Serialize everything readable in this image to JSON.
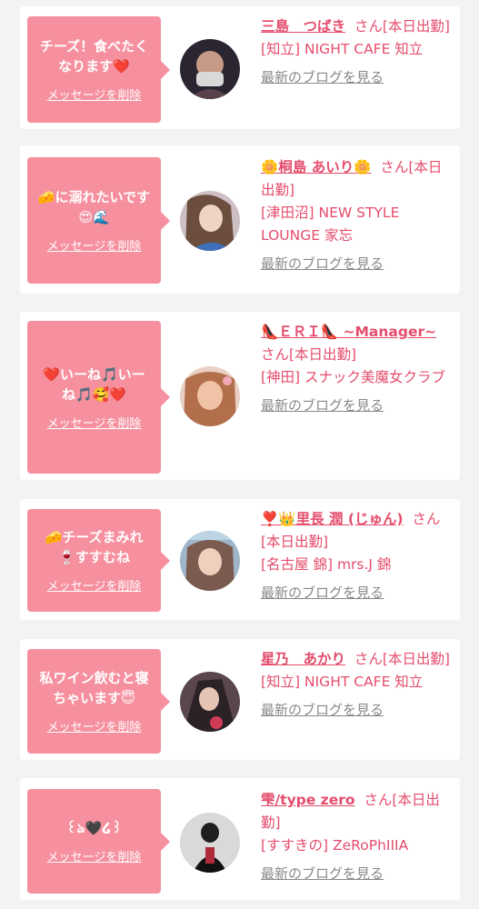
{
  "cards": [
    {
      "message": "チーズ！食べたく\nなります❤️",
      "delete_label": "メッセージを削除",
      "name": "三島　つばき",
      "suffix": "さん[本日出勤]",
      "shop": "[知立] NIGHT CAFE 知立",
      "blog_label": "最新のブログを見る",
      "avatar_color": "#2a2530"
    },
    {
      "message": "🧀に溺れたいです\n😍🌊",
      "delete_label": "メッセージを削除",
      "name": "🌼桐島 あいり🌼",
      "suffix": "さん[本日出勤]",
      "shop": "[津田沼] NEW STYLE LOUNGE 家忘",
      "blog_label": "最新のブログを見る",
      "avatar_color": "#b9a3a7"
    },
    {
      "message": "❤️いーね🎵いー\nね🎵🥰❤️",
      "delete_label": "メッセージを削除",
      "name": "👠ＥＲＩ👠 ~Manager~",
      "suffix": "さん[本日出勤]",
      "shop": "[神田] スナック美魔女クラブ",
      "blog_label": "最新のブログを見る",
      "avatar_color": "#d99877"
    },
    {
      "message": "🧀チーズまみれ\n🍷すすむね",
      "delete_label": "メッセージを削除",
      "name": "❣️👑里長 潤 (じゅん)",
      "suffix": "さん[本日出勤]",
      "shop": "[名古屋 錦] mrs.J 錦",
      "blog_label": "最新のブログを見る",
      "avatar_color": "#9fb6c8"
    },
    {
      "message": "私ワイン飲むと寝\nちゃいます😇",
      "delete_label": "メッセージを削除",
      "name": "星乃　あかり",
      "suffix": "さん[本日出勤]",
      "shop": "[知立] NIGHT CAFE 知立",
      "blog_label": "最新のブログを見る",
      "avatar_color": "#4a3a40"
    },
    {
      "message": "꒰ঌ🖤໒꒱",
      "delete_label": "メッセージを削除",
      "name": "雫/type zero",
      "suffix": "さん[本日出勤]",
      "shop": "[すすきの] ZeRoPhIIIA",
      "blog_label": "最新のブログを見る",
      "avatar_color": "#3a3a3a"
    }
  ]
}
